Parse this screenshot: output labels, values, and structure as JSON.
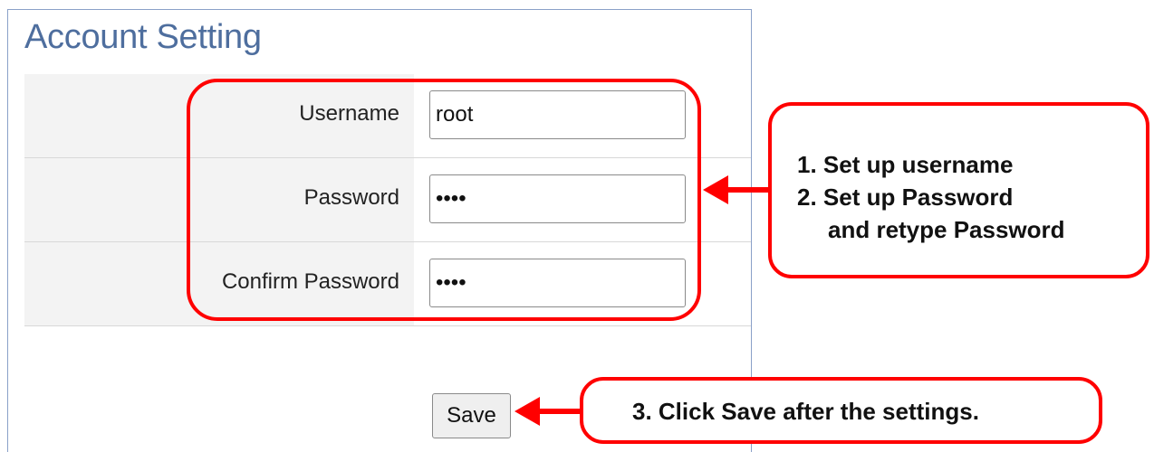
{
  "panel": {
    "title": "Account Setting"
  },
  "form": {
    "username": {
      "label": "Username",
      "value": "root"
    },
    "password": {
      "label": "Password",
      "value": "••••"
    },
    "confirm_password": {
      "label": "Confirm Password",
      "value": "••••"
    },
    "save_label": "Save"
  },
  "annotations": {
    "callout_1": {
      "line1": "1. Set up username",
      "line2": "2. Set up Password",
      "line3": "and retype Password"
    },
    "callout_2": {
      "text": "3. Click Save after the settings."
    }
  },
  "colors": {
    "annotation_red": "#ff0000",
    "title_blue": "#4e6e9e",
    "label_bg": "#f3f3f3"
  }
}
